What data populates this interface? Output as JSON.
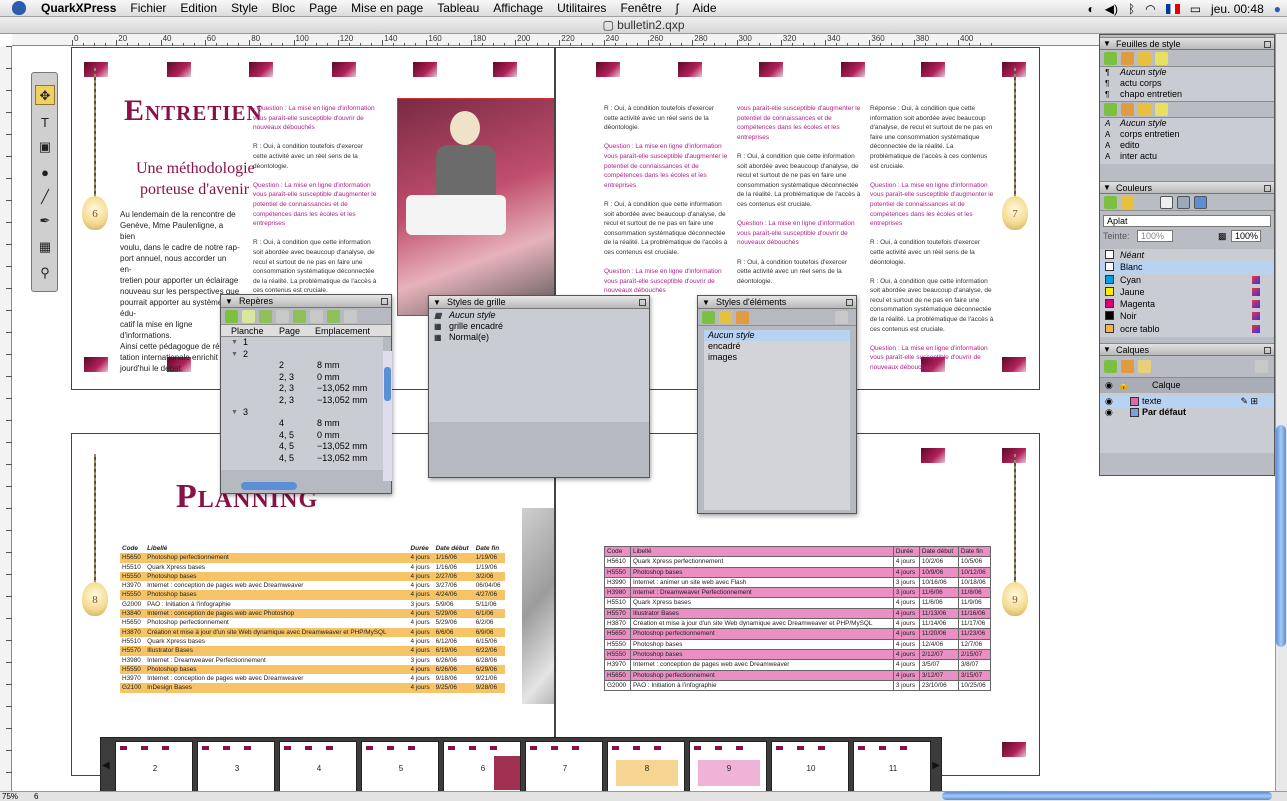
{
  "menubar": {
    "app_name": "QuarkXPress",
    "items": [
      "Fichier",
      "Edition",
      "Style",
      "Bloc",
      "Page",
      "Mise en page",
      "Tableau",
      "Affichage",
      "Utilitaires",
      "Fenêtre",
      "Aide"
    ],
    "clock": "jeu. 00:48"
  },
  "document": {
    "title": "bulletin2.qxp"
  },
  "ruler": {
    "labels": [
      "0",
      "20",
      "40",
      "60",
      "80",
      "100",
      "120",
      "140",
      "160",
      "180",
      "200",
      "220",
      "240",
      "260",
      "280",
      "300",
      "320",
      "340",
      "360",
      "380",
      "400"
    ]
  },
  "spread1": {
    "left_page": {
      "title": "Entretien",
      "subtitle_line1": "Une méthodologie",
      "subtitle_line2": "porteuse d'avenir",
      "page_number": "6",
      "body": "Au lendemain de la rencontre de\nGenève, Mme Paulenligne, a bien\nvoulu, dans le cadre de notre rap-\nport annuel, nous accorder un en-\ntretien pour apporter un éclairage\nnouveau sur les perspectives que\npourrait apporter au système édu-\ncatif la mise en ligne d'informations.\nAinsi cette pédagogue de répu-\ntation internationale enrichit au-\njourd'hui le débat.",
      "column_q": "Question : La mise en ligne d'information vous paraît-elle susceptible d'ouvrir de nouveaux débouchés",
      "column_r1": "R : Oui, à condition toutefois d'exercer cette activité avec un réel sens de la déontologie.",
      "column_q2": "Question : La mise en ligne d'information vous paraît-elle susceptible d'augmenter le potentiel de connaissances et de compétences dans les écoles et les entreprises",
      "column_r2": "R : Oui, à condition que cette information soit abordée avec beaucoup d'analyse, de recul et surtout de ne pas en faire une consommation systématique déconnectée de la réalité. La problématique de l'accès à ces contenus est cruciale."
    },
    "right_page": {
      "page_number": "7",
      "column_a_r1": "R : Oui, à condition toutefois d'exercer cette activité avec un réel sens de la déontologie.",
      "column_a_q1": "Question : La mise en ligne d'information vous paraît-elle susceptible d'augmenter le potentiel de connaissances et de compétences dans les écoles et les entreprises",
      "column_a_r2": "R : Oui, à condition que cette information soit abordée avec beaucoup d'analyse, de recul et surtout de ne pas en faire une consommation systématique déconnectée de la réalité. La problématique de l'accès à ces contenus est cruciale.",
      "column_a_q2": "Question : La mise en ligne d'information vous paraît-elle susceptible d'ouvrir de nouveaux débouchés",
      "column_b_q1": "vous paraît-elle susceptible d'augmenter le potentiel de connaissances et de compétences dans les écoles et les entreprises",
      "column_b_r1": "R : Oui, à condition que cette information soit abordée avec beaucoup d'analyse, de recul et surtout de ne pas en faire une consommation systématique déconnectée de la réalité. La problématique de l'accès à ces contenus est cruciale.",
      "column_b_q2": "Question : La mise en ligne d'information vous paraît-elle susceptible d'ouvrir de nouveaux débouchés",
      "column_b_r2": "R : Oui, à condition toutefois d'exercer cette activité avec un réel sens de la déontologie.",
      "column_c_r1": "Réponse : Oui, à condition que cette information soit abordée avec beaucoup d'analyse, de recul et surtout de ne pas en faire une consommation systématique déconnectée de la réalité. La problématique de l'accès à ces contenus est cruciale.",
      "column_c_q1": "Question : La mise en ligne d'information vous paraît-elle susceptible d'augmenter le potentiel de connaissances et de compétences dans les écoles et les entreprises",
      "column_c_r2": "R : Oui, à condition toutefois d'exercer cette activité avec un réel sens de la déontologie.",
      "column_c_r3": "R : Oui, à condition que cette information soit abordée avec beaucoup d'analyse, de recul et surtout de ne pas en faire une consommation systématique déconnectée de la réalité. La problématique de l'accès à ces contenus est cruciale.",
      "column_c_q2": "Question : La mise en ligne d'information vous paraît-elle susceptible d'ouvrir de nouveaux débouchés"
    }
  },
  "spread2": {
    "left_page": {
      "title": "Planning",
      "page_number": "8"
    },
    "right_page": {
      "page_number": "9"
    },
    "yellow_table": {
      "headers": [
        "Code",
        "Libellé",
        "Durée",
        "Date début",
        "Date fin"
      ],
      "rows": [
        {
          "cells": [
            "H5650",
            "Photoshop perfectionnement",
            "4 jours",
            "1/16/06",
            "1/19/06"
          ],
          "hl": true
        },
        {
          "cells": [
            "H5510",
            "Quark Xpress bases",
            "4 jours",
            "1/16/06",
            "1/19/06"
          ],
          "hl": false
        },
        {
          "cells": [
            "H5550",
            "Photoshop bases",
            "4 jours",
            "2/27/06",
            "3/2/06"
          ],
          "hl": true
        },
        {
          "cells": [
            "H3970",
            "Internet : conception de pages web avec Dreamweaver",
            "4 jours",
            "3/27/06",
            "06/04/06"
          ],
          "hl": false
        },
        {
          "cells": [
            "H5550",
            "Photoshop bases",
            "4 jours",
            "4/24/06",
            "4/27/06"
          ],
          "hl": true
        },
        {
          "cells": [
            "G2000",
            "PAO : Initiation à l'infographie",
            "3 jours",
            "5/9/06",
            "5/11/06"
          ],
          "hl": false
        },
        {
          "cells": [
            "H3840",
            "Internet : conception de pages web avec Photoshop",
            "4 jours",
            "5/29/06",
            "6/1/06"
          ],
          "hl": true
        },
        {
          "cells": [
            "H5650",
            "Photoshop perfectionnement",
            "4 jours",
            "5/29/06",
            "6/2/06"
          ],
          "hl": false
        },
        {
          "cells": [
            "H3870",
            "Création et mise à jour d'un site Web dynamique avec Dreamweaver et PHP/MySQL",
            "4 jours",
            "6/6/06",
            "6/9/06"
          ],
          "hl": true
        },
        {
          "cells": [
            "H5510",
            "Quark Xpress bases",
            "4 jours",
            "6/12/06",
            "6/15/06"
          ],
          "hl": false
        },
        {
          "cells": [
            "H5570",
            "Illustrator Bases",
            "4 jours",
            "6/19/06",
            "6/22/06"
          ],
          "hl": true
        },
        {
          "cells": [
            "H3980",
            "Internet : Dreamweaver Perfectionnement",
            "3 jours",
            "6/26/06",
            "6/28/06"
          ],
          "hl": false
        },
        {
          "cells": [
            "H5550",
            "Photoshop bases",
            "4 jours",
            "6/26/06",
            "6/29/06"
          ],
          "hl": true
        },
        {
          "cells": [
            "H3970",
            "Internet : conception de pages web avec Dreamweaver",
            "4 jours",
            "9/18/06",
            "9/21/06"
          ],
          "hl": false
        },
        {
          "cells": [
            "G2100",
            "InDesign Bases",
            "4 jours",
            "9/25/06",
            "9/28/06"
          ],
          "hl": true
        }
      ]
    },
    "pink_table": {
      "headers": [
        "Code",
        "Libellé",
        "Durée",
        "Date début",
        "Date fin"
      ],
      "rows": [
        {
          "cells": [
            "H5610",
            "Quark Xpress perfectionnement",
            "4 jours",
            "10/2/06",
            "10/5/06"
          ],
          "hl": false
        },
        {
          "cells": [
            "H5550",
            "Photoshop bases",
            "4 jours",
            "10/9/06",
            "10/12/06"
          ],
          "hl": true
        },
        {
          "cells": [
            "H3990",
            "Internet : animer un site web avec Flash",
            "3 jours",
            "10/16/06",
            "10/18/06"
          ],
          "hl": false
        },
        {
          "cells": [
            "H3980",
            "Internet : Dreamweaver Perfectionnement",
            "3 jours",
            "11/6/06",
            "11/8/06"
          ],
          "hl": true
        },
        {
          "cells": [
            "H5510",
            "Quark Xpress bases",
            "4 jours",
            "11/6/06",
            "11/9/06"
          ],
          "hl": false
        },
        {
          "cells": [
            "H5570",
            "Illustrator Bases",
            "4 jours",
            "11/13/06",
            "11/16/06"
          ],
          "hl": true
        },
        {
          "cells": [
            "H3870",
            "Création et mise à jour d'un site Web dynamique avec Dreamweaver et PHP/MySQL",
            "4 jours",
            "11/14/06",
            "11/17/06"
          ],
          "hl": false
        },
        {
          "cells": [
            "H5650",
            "Photoshop perfectionnement",
            "4 jours",
            "11/20/06",
            "11/23/06"
          ],
          "hl": true
        },
        {
          "cells": [
            "H5550",
            "Photoshop bases",
            "4 jours",
            "12/4/06",
            "12/7/06"
          ],
          "hl": false
        },
        {
          "cells": [
            "H5550",
            "Photoshop bases",
            "4 jours",
            "2/12/07",
            "2/15/07"
          ],
          "hl": true
        },
        {
          "cells": [
            "H3970",
            "Internet : conception de pages web avec Dreamweaver",
            "4 jours",
            "3/5/07",
            "3/8/07"
          ],
          "hl": false
        },
        {
          "cells": [
            "H5650",
            "Photoshop perfectionnement",
            "4 jours",
            "3/12/07",
            "3/15/07"
          ],
          "hl": true
        },
        {
          "cells": [
            "G2000",
            "PAO : Initiation à l'infographie",
            "3 jours",
            "23/10/06",
            "10/25/06"
          ],
          "hl": false
        }
      ]
    }
  },
  "palette_reperes": {
    "title": "Repères",
    "columns": [
      "Planche",
      "Page",
      "Emplacement"
    ],
    "rows": [
      {
        "planche": "1",
        "page": "",
        "loc": ""
      },
      {
        "planche": "2",
        "page": "",
        "loc": ""
      },
      {
        "planche": "",
        "page": "2",
        "loc": "8 mm"
      },
      {
        "planche": "",
        "page": "2, 3",
        "loc": "0 mm"
      },
      {
        "planche": "",
        "page": "2, 3",
        "loc": "−13,052 mm"
      },
      {
        "planche": "",
        "page": "2, 3",
        "loc": "−13,052 mm"
      },
      {
        "planche": "3",
        "page": "",
        "loc": ""
      },
      {
        "planche": "",
        "page": "4",
        "loc": "8 mm"
      },
      {
        "planche": "",
        "page": "4, 5",
        "loc": "0 mm"
      },
      {
        "planche": "",
        "page": "4, 5",
        "loc": "−13,052 mm"
      },
      {
        "planche": "",
        "page": "4, 5",
        "loc": "−13,052 mm"
      }
    ]
  },
  "palette_grid": {
    "title": "Styles de grille",
    "items": [
      "Aucun style",
      "grille encadré",
      "Normal(e)"
    ]
  },
  "palette_elements": {
    "title": "Styles d'éléments",
    "items": [
      "Aucun style",
      "encadré",
      "images"
    ]
  },
  "palette_stylesheets": {
    "title": "Feuilles de style",
    "paragraph_styles": [
      "Aucun style",
      "actu corps",
      "chapo entretien"
    ],
    "character_styles": [
      "Aucun style",
      "corps entretien",
      "edito",
      "inter actu"
    ]
  },
  "palette_colors": {
    "title": "Couleurs",
    "mode": "Aplat",
    "tint_label": "Teinte:",
    "tint_value": "100%",
    "opacity_value": "100%",
    "colors": [
      {
        "name": "Néant",
        "hex": "#ffffff",
        "it": true
      },
      {
        "name": "Blanc",
        "hex": "#ffffff",
        "it": false,
        "sel": true
      },
      {
        "name": "Cyan",
        "hex": "#00a0e0",
        "it": false
      },
      {
        "name": "Jaune",
        "hex": "#ffee00",
        "it": false
      },
      {
        "name": "Magenta",
        "hex": "#d6007a",
        "it": false
      },
      {
        "name": "Noir",
        "hex": "#000000",
        "it": false
      },
      {
        "name": "ocre tablo",
        "hex": "#f4b64a",
        "it": false
      }
    ]
  },
  "palette_layers": {
    "title": "Calques",
    "header": "Calque",
    "layers": [
      {
        "name": "texte",
        "hex": "#e06aa6"
      },
      {
        "name": "Par défaut",
        "hex": "#7fa0e0"
      }
    ]
  },
  "thumbnails": [
    "2",
    "3",
    "4",
    "5",
    "6",
    "7",
    "8",
    "9",
    "10",
    "11"
  ],
  "status": {
    "zoom": "75%",
    "page": "6"
  },
  "colors": {
    "accent": "#8a1148",
    "question": "#b01e86",
    "yellow_row": "#f6c466",
    "pink_row": "#ea8ec3"
  }
}
